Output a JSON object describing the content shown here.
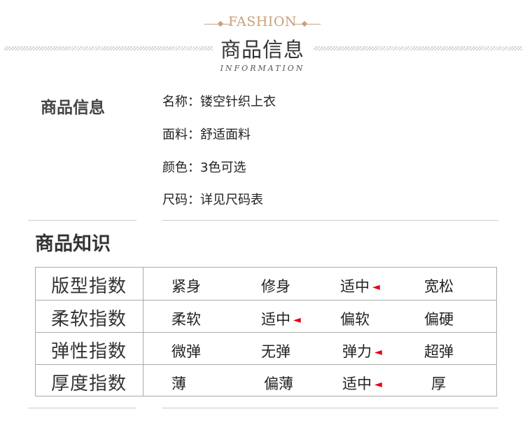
{
  "header": {
    "fashion": "FASHION",
    "title": "商品信息",
    "subtitle": "INFORMATION"
  },
  "info": {
    "heading": "商品信息",
    "lines": [
      "名称：镂空针织上衣",
      "面料：舒适面料",
      "颜色：3色可选",
      "尺码：详见尺码表"
    ]
  },
  "knowledge": {
    "heading": "商品知识",
    "marker_color": "#e60012",
    "marker_glyph": "◄",
    "rows": [
      {
        "label": "版型指数",
        "options": [
          "紧身",
          "修身",
          "适中",
          "宽松"
        ],
        "selected": 2
      },
      {
        "label": "柔软指数",
        "options": [
          "柔软",
          "适中",
          "偏软",
          "偏硬"
        ],
        "selected": 1
      },
      {
        "label": "弹性指数",
        "options": [
          "微弹",
          "无弹",
          "弹力",
          "超弹"
        ],
        "selected": 2
      },
      {
        "label": "厚度指数",
        "options": [
          "薄",
          "偏薄",
          "适中",
          "厚"
        ],
        "selected": 2
      }
    ]
  }
}
